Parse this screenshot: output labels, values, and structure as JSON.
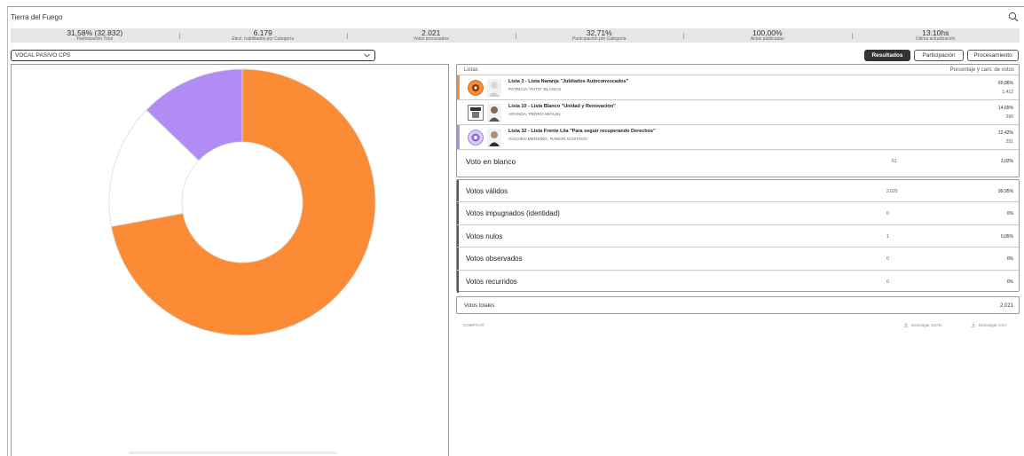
{
  "header": {
    "title": "Tierra del Fuego"
  },
  "stats": [
    {
      "value": "31,58% (32.832)",
      "label": "Participación Total"
    },
    {
      "value": "6.179",
      "label": "Elect. habilitados por Categoría"
    },
    {
      "value": "2.021",
      "label": "Votos procesados"
    },
    {
      "value": "32,71%",
      "label": "Participación por Categoría"
    },
    {
      "value": "100,00%",
      "label": "Actas publicadas"
    },
    {
      "value": "13:10hs",
      "label": "Última actualización"
    }
  ],
  "category_select": {
    "selected": "VOCAL PASIVO CPS"
  },
  "tabs": [
    "Resultados",
    "Participación",
    "Procesamiento"
  ],
  "results": {
    "header_left": "Listas",
    "header_right": "Porcentaje y cant. de votos",
    "lists": [
      {
        "name": "Lista 3 - Lista Naranja \"Jubilados Autoconvocados\"",
        "candidate": "PATRICIA \"PATO\" BLANCO",
        "percent": "69,86%",
        "count": "1.412",
        "color": "#fb8c35"
      },
      {
        "name": "Lista 10 - Lista Blanco \"Unidad y Renovación\"",
        "candidate": "ARANDA, PEDRO MIGUEL",
        "percent": "14,65%",
        "count": "296",
        "color": "#ffffff"
      },
      {
        "name": "Lista 32 - Lista Frente Lila \"Para seguir recuperando Derechos\"",
        "candidate": "GACHES MENSING, RAMON GUSTAVO",
        "percent": "12,42%",
        "count": "251",
        "color": "#b28cf5"
      }
    ],
    "blank": {
      "label": "Voto en blanco",
      "count": "61",
      "percent": "3,02%"
    }
  },
  "votes": [
    {
      "label": "Votos válidos",
      "count": "2.020",
      "percent": "99,95%"
    },
    {
      "label": "Votos impugnados (identidad)",
      "count": "0",
      "percent": "0%"
    },
    {
      "label": "Votos nulos",
      "count": "1",
      "percent": "0,05%"
    },
    {
      "label": "Votos observados",
      "count": "0",
      "percent": "0%"
    },
    {
      "label": "Votos recurridos",
      "count": "0",
      "percent": "0%"
    }
  ],
  "totals": {
    "label": "Votos totales",
    "value": "2.021"
  },
  "footer": {
    "brand": "COMPTIA®",
    "download_json": "Descargar JSON",
    "download_csv": "Descargar CSV"
  },
  "chart_data": {
    "type": "pie",
    "categories": [
      "Lista Naranja",
      "Lista Blanco",
      "Lista Frente Lila"
    ],
    "values": [
      69.86,
      14.65,
      12.42
    ],
    "colors": [
      "#fb8c35",
      "#ffffff",
      "#b28cf5"
    ]
  }
}
